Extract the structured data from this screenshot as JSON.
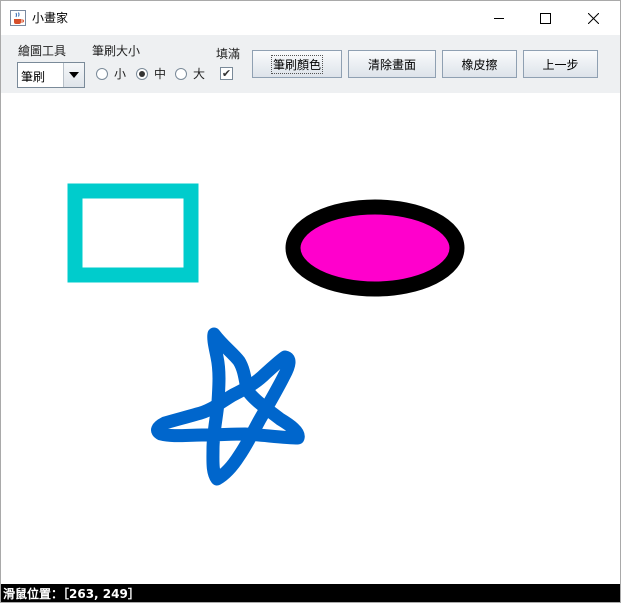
{
  "window": {
    "title": "小畫家",
    "app_icon": "java-cup-icon",
    "controls": [
      "minimize-icon",
      "maximize-icon",
      "close-icon"
    ]
  },
  "toolbar": {
    "tool_label": "繪圖工具",
    "tool_selected": "筆刷",
    "brush_size_label": "筆刷大小",
    "sizes": [
      {
        "label": "小",
        "selected": false
      },
      {
        "label": "中",
        "selected": true
      },
      {
        "label": "大",
        "selected": false
      }
    ],
    "fill_label": "填滿",
    "fill_checked": true,
    "buttons": {
      "brush_color": "筆刷顏色",
      "clear": "清除畫面",
      "eraser": "橡皮擦",
      "undo": "上一步"
    }
  },
  "canvas": {
    "shapes": [
      {
        "kind": "rectangle-outline",
        "color": "#00cccc"
      },
      {
        "kind": "ellipse-filled",
        "fill": "#ff00cc",
        "stroke": "#000000"
      },
      {
        "kind": "freehand-star",
        "color": "#0066cc"
      }
    ]
  },
  "status": {
    "text": "滑鼠位置：［263, 249］"
  }
}
